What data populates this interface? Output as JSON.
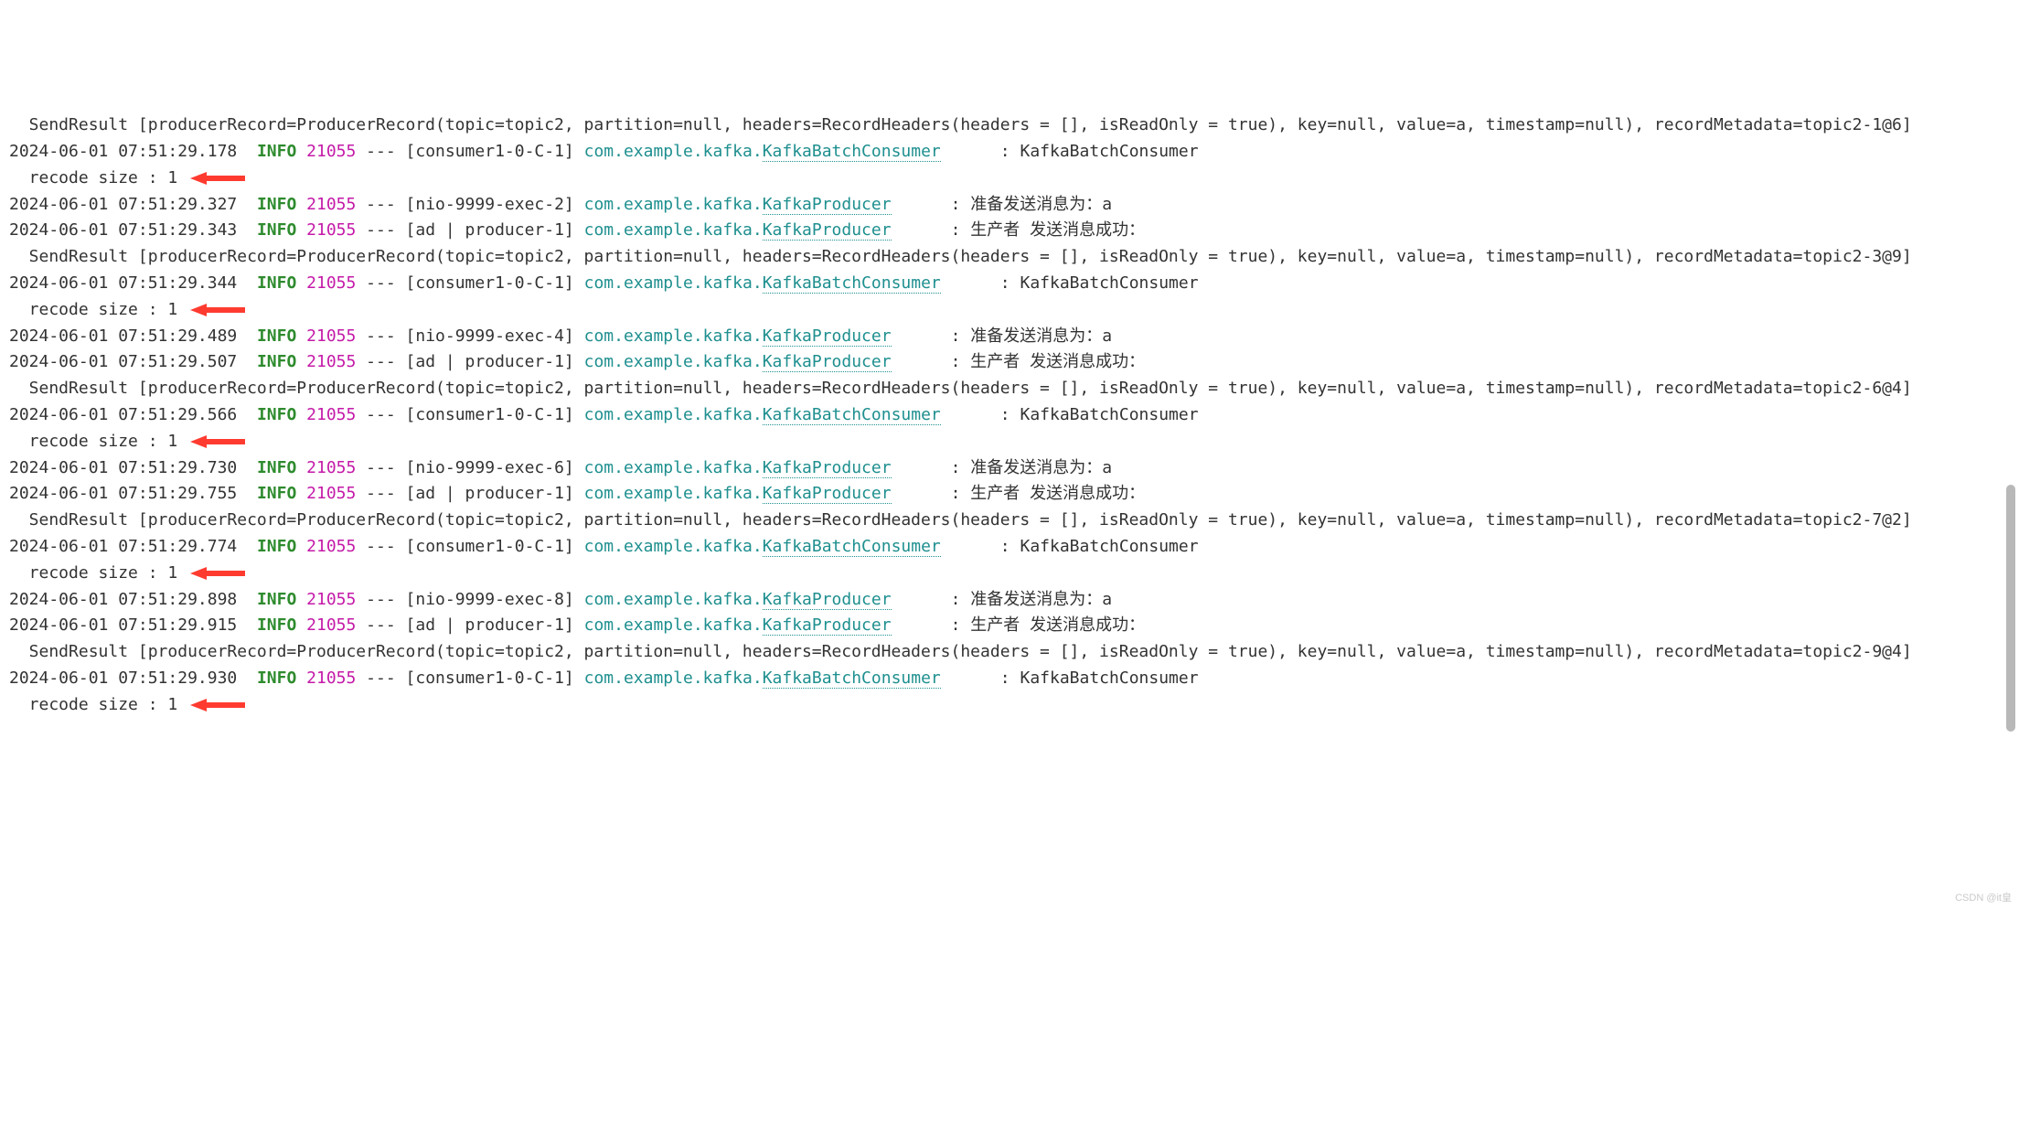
{
  "level": "INFO",
  "pid": "21055",
  "watermark": "CSDN @it皇",
  "lines": [
    {
      "type": "cont",
      "text": " SendResult [producerRecord=ProducerRecord(topic=topic2, partition=null, headers=RecordHeaders(headers = [], isReadOnly = true), key=null, value=a, timestamp=null), recordMetadata=topic2-1@6]"
    },
    {
      "type": "log",
      "ts": "2024-06-01 07:51:29.178",
      "thread": "[consumer1-0-C-1]",
      "loggerPkg": "com.example.kafka.",
      "loggerClass": "KafkaBatchConsumer",
      "msg": "KafkaBatchConsumer recode size : 1",
      "arrow": true
    },
    {
      "type": "log",
      "ts": "2024-06-01 07:51:29.327",
      "thread": "[nio-9999-exec-2]",
      "loggerPkg": "com.example.kafka.",
      "loggerClass": "KafkaProducer",
      "msg": "准备发送消息为：a"
    },
    {
      "type": "log",
      "ts": "2024-06-01 07:51:29.343",
      "thread": "[ad | producer-1]",
      "loggerPkg": "com.example.kafka.",
      "loggerClass": "KafkaProducer",
      "msg": "生产者 发送消息成功："
    },
    {
      "type": "cont",
      "text": " SendResult [producerRecord=ProducerRecord(topic=topic2, partition=null, headers=RecordHeaders(headers = [], isReadOnly = true), key=null, value=a, timestamp=null), recordMetadata=topic2-3@9]"
    },
    {
      "type": "log",
      "ts": "2024-06-01 07:51:29.344",
      "thread": "[consumer1-0-C-1]",
      "loggerPkg": "com.example.kafka.",
      "loggerClass": "KafkaBatchConsumer",
      "msg": "KafkaBatchConsumer recode size : 1",
      "arrow": true
    },
    {
      "type": "log",
      "ts": "2024-06-01 07:51:29.489",
      "thread": "[nio-9999-exec-4]",
      "loggerPkg": "com.example.kafka.",
      "loggerClass": "KafkaProducer",
      "msg": "准备发送消息为：a"
    },
    {
      "type": "log",
      "ts": "2024-06-01 07:51:29.507",
      "thread": "[ad | producer-1]",
      "loggerPkg": "com.example.kafka.",
      "loggerClass": "KafkaProducer",
      "msg": "生产者 发送消息成功："
    },
    {
      "type": "cont",
      "text": " SendResult [producerRecord=ProducerRecord(topic=topic2, partition=null, headers=RecordHeaders(headers = [], isReadOnly = true), key=null, value=a, timestamp=null), recordMetadata=topic2-6@4]"
    },
    {
      "type": "log",
      "ts": "2024-06-01 07:51:29.566",
      "thread": "[consumer1-0-C-1]",
      "loggerPkg": "com.example.kafka.",
      "loggerClass": "KafkaBatchConsumer",
      "msg": "KafkaBatchConsumer recode size : 1",
      "arrow": true
    },
    {
      "type": "log",
      "ts": "2024-06-01 07:51:29.730",
      "thread": "[nio-9999-exec-6]",
      "loggerPkg": "com.example.kafka.",
      "loggerClass": "KafkaProducer",
      "msg": "准备发送消息为：a"
    },
    {
      "type": "log",
      "ts": "2024-06-01 07:51:29.755",
      "thread": "[ad | producer-1]",
      "loggerPkg": "com.example.kafka.",
      "loggerClass": "KafkaProducer",
      "msg": "生产者 发送消息成功："
    },
    {
      "type": "cont",
      "text": " SendResult [producerRecord=ProducerRecord(topic=topic2, partition=null, headers=RecordHeaders(headers = [], isReadOnly = true), key=null, value=a, timestamp=null), recordMetadata=topic2-7@2]"
    },
    {
      "type": "log",
      "ts": "2024-06-01 07:51:29.774",
      "thread": "[consumer1-0-C-1]",
      "loggerPkg": "com.example.kafka.",
      "loggerClass": "KafkaBatchConsumer",
      "msg": "KafkaBatchConsumer recode size : 1",
      "arrow": true
    },
    {
      "type": "log",
      "ts": "2024-06-01 07:51:29.898",
      "thread": "[nio-9999-exec-8]",
      "loggerPkg": "com.example.kafka.",
      "loggerClass": "KafkaProducer",
      "msg": "准备发送消息为：a"
    },
    {
      "type": "log",
      "ts": "2024-06-01 07:51:29.915",
      "thread": "[ad | producer-1]",
      "loggerPkg": "com.example.kafka.",
      "loggerClass": "KafkaProducer",
      "msg": "生产者 发送消息成功："
    },
    {
      "type": "cont",
      "text": " SendResult [producerRecord=ProducerRecord(topic=topic2, partition=null, headers=RecordHeaders(headers = [], isReadOnly = true), key=null, value=a, timestamp=null), recordMetadata=topic2-9@4]"
    },
    {
      "type": "log",
      "ts": "2024-06-01 07:51:29.930",
      "thread": "[consumer1-0-C-1]",
      "loggerPkg": "com.example.kafka.",
      "loggerClass": "KafkaBatchConsumer",
      "msg": "KafkaBatchConsumer recode size : 1",
      "arrow": true
    }
  ]
}
